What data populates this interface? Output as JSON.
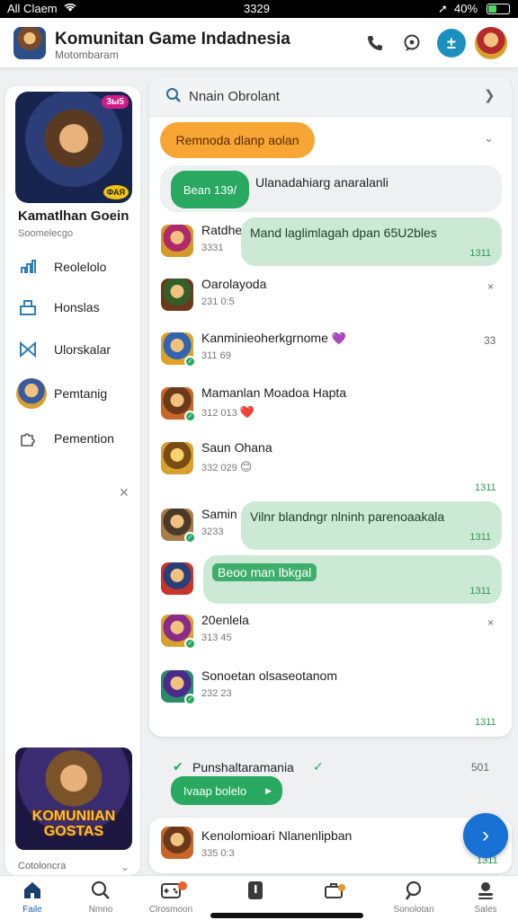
{
  "status_bar": {
    "carrier": "All Claem",
    "time": "3329",
    "battery": "40%",
    "battery_level": 0.4
  },
  "header": {
    "title": "Komunitan Game Indadnesia",
    "subtitle": "Motombaram"
  },
  "left_panel": {
    "game_rating": "3ы5",
    "game_badge": "ФАЯ",
    "title": "Kamatlhan Goein",
    "subtitle": "Soomelecgo",
    "menu": [
      {
        "label": "Reolelolo",
        "icon": "chart-icon"
      },
      {
        "label": "Honslas",
        "icon": "group-icon"
      },
      {
        "label": "Ulorskalar",
        "icon": "bow-icon"
      },
      {
        "label": "Pemtanig",
        "icon": "avatar"
      },
      {
        "label": "Pemention",
        "icon": "puzzle-icon"
      }
    ],
    "promo_text_line1": "KOMUNIIAN",
    "promo_text_line2": "GOSTAS",
    "footer": "Cotoloncra"
  },
  "chat": {
    "search_placeholder": "Nnain Obrolant",
    "pinned_pill": "Remnoda dlanp aolan",
    "first_bubble": {
      "pill": "Bean 139/",
      "text": "Ulanadahiarg anaralanli"
    },
    "rows": [
      {
        "name": "Ratdhe",
        "meta": "3331",
        "bubble": "Mand laglimlagah dpan 65U2bles",
        "time": "1311"
      },
      {
        "name": "Oarolayoda",
        "meta": "231 0:5",
        "right": "×"
      },
      {
        "name": "Kanminieoherkgrnome",
        "meta": "311 69",
        "right": "33",
        "emoji": "💜"
      },
      {
        "name": "Mamanlan Moadoa Hapta",
        "meta": "312 013",
        "emoji": "❤️"
      },
      {
        "name": "Saun Ohana",
        "meta": "332 029",
        "emoji": "😊",
        "time": "1311"
      },
      {
        "name": "Samin",
        "meta": "3233",
        "bubble": "Vilnr blandngr nlninh parenoaakala",
        "time": "1311"
      },
      {
        "name": "",
        "meta": "",
        "bubble": "Beoo man lbkgal",
        "time": "1311"
      },
      {
        "name": "20enlela",
        "meta": "313 45",
        "right": "×"
      },
      {
        "name": "Sonoetan olsaseotanom",
        "meta": "232 23",
        "time": "1311"
      }
    ]
  },
  "status_card": {
    "title": "Punshaltaramania",
    "check": "✓",
    "count": "501",
    "pill": "Ivaap bolelo"
  },
  "bottom_card": {
    "name": "Kenolomioari Nlanenlipban",
    "meta": "335 0:3",
    "time": "1311"
  },
  "nav": [
    {
      "label": "Faile",
      "icon": "home-icon",
      "active": true
    },
    {
      "label": "Nmno",
      "icon": "search-icon"
    },
    {
      "label": "Clrosmoon",
      "icon": "gamepad-icon"
    },
    {
      "label": "",
      "icon": "bookmark-icon"
    },
    {
      "label": "",
      "icon": "briefcase-icon"
    },
    {
      "label": "Sonolotan",
      "icon": "search-icon"
    },
    {
      "label": "Sales",
      "icon": "user-icon"
    }
  ],
  "colors": {
    "accent": "#1d8fbf",
    "green": "#28a860",
    "orange": "#f7a534",
    "fab": "#1872d6"
  }
}
